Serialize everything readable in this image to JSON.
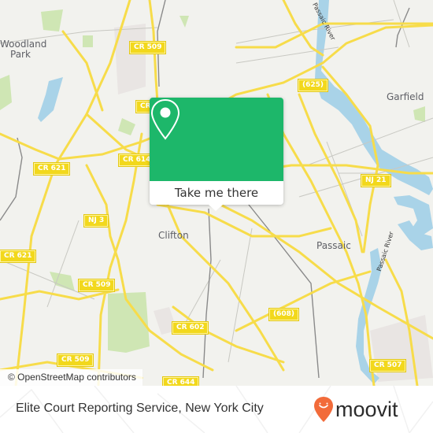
{
  "map": {
    "attribution": "© OpenStreetMap contributors",
    "places": [
      {
        "id": "woodland-park-1",
        "label": "Woodland"
      },
      {
        "id": "woodland-park-2",
        "label": "Park"
      },
      {
        "id": "garfield",
        "label": "Garfield"
      },
      {
        "id": "clifton",
        "label": "Clifton"
      },
      {
        "id": "passaic",
        "label": "Passaic"
      }
    ],
    "rivers": [
      {
        "id": "passaic-river-north",
        "label": "Passaic River"
      },
      {
        "id": "passaic-river-south",
        "label": "Passaic River"
      }
    ],
    "shields": [
      {
        "id": "cr509-top",
        "label": "CR 509"
      },
      {
        "id": "cr-partial",
        "label": "CR"
      },
      {
        "id": "cr614",
        "label": "CR 614"
      },
      {
        "id": "cr621-upper",
        "label": "CR 621"
      },
      {
        "id": "cr621-lower",
        "label": "CR 621"
      },
      {
        "id": "nj3",
        "label": "NJ 3"
      },
      {
        "id": "cr509-mid",
        "label": "CR 509"
      },
      {
        "id": "cr509-bottom",
        "label": "CR 509"
      },
      {
        "id": "cr602",
        "label": "CR 602"
      },
      {
        "id": "cr644",
        "label": "CR 644"
      },
      {
        "id": "r625",
        "label": "(625)"
      },
      {
        "id": "nj21",
        "label": "NJ 21"
      },
      {
        "id": "r608",
        "label": "(608)"
      },
      {
        "id": "cr507",
        "label": "CR 507"
      }
    ],
    "colors": {
      "land": "#f2f2ee",
      "road_major": "#f7dc4a",
      "water": "#a9d3e8",
      "park": "#cfe6b4"
    }
  },
  "popup": {
    "icon": "map-pin-icon",
    "cta_label": "Take me there",
    "accent": "#1db76a"
  },
  "footer": {
    "place_name": "Elite Court Reporting Service, New York City",
    "brand": {
      "name": "moovit",
      "logo_icon": "moovit-pin-smile-icon",
      "logo_color": "#f26b3a"
    }
  }
}
